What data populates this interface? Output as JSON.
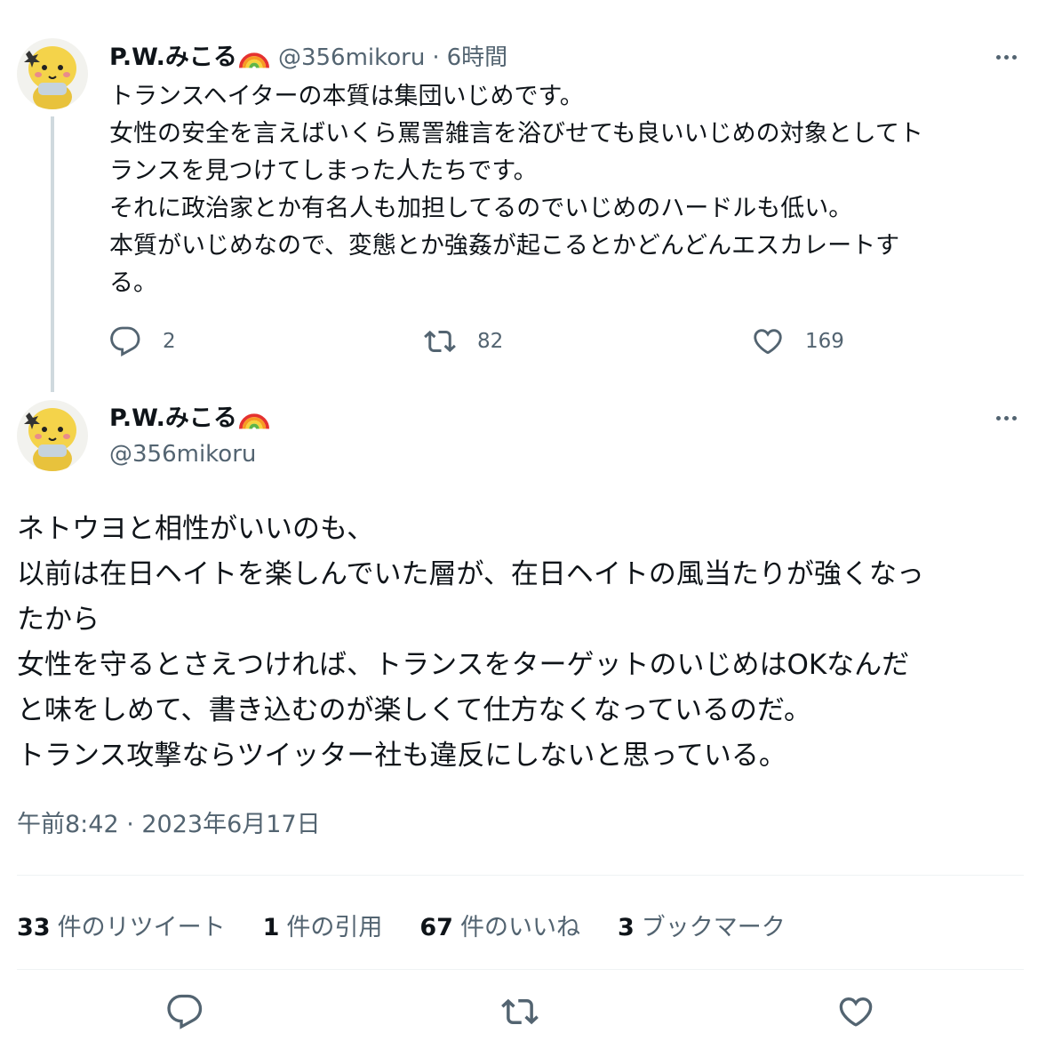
{
  "parent_tweet": {
    "display_name": "P.W.みこる",
    "handle": "@356mikoru",
    "separator": "·",
    "time_ago": "6時間",
    "lines": [
      "トランスヘイターの本質は集団いじめです。",
      "女性の安全を言えばいくら罵詈雑言を浴びせても良いいじめの対象としてト",
      "ランスを見つけてしまった人たちです。",
      "それに政治家とか有名人も加担してるのでいじめのハードルも低い。",
      "本質がいじめなので、変態とか強姦が起こるとかどんどんエスカレートす",
      "る。"
    ],
    "replies": "2",
    "retweets": "82",
    "likes": "169"
  },
  "main_tweet": {
    "display_name": "P.W.みこる",
    "handle": "@356mikoru",
    "lines": [
      "ネトウヨと相性がいいのも、",
      "以前は在日ヘイトを楽しんでいた層が、在日ヘイトの風当たりが強くなっ",
      "たから",
      "女性を守るとさえつければ、トランスをターゲットのいじめはOKなんだ",
      "と味をしめて、書き込むのが楽しくて仕方なくなっているのだ。",
      "トランス攻撃ならツイッター社も違反にしないと思っている。"
    ],
    "timestamp": "午前8:42 · 2023年6月17日",
    "stats": {
      "retweets_count": "33",
      "retweets_label": "件のリツイート",
      "quotes_count": "1",
      "quotes_label": "件の引用",
      "likes_count": "67",
      "likes_label": "件のいいね",
      "bookmarks_count": "3",
      "bookmarks_label": "ブックマーク"
    }
  },
  "icons": {
    "reply": "reply-icon",
    "retweet": "retweet-icon",
    "like": "heart-icon",
    "more": "more-icon",
    "verified_emoji": "rainbow-emoji"
  },
  "colors": {
    "text": "#0f1419",
    "secondary": "#536471",
    "thread_line": "#cfd9de",
    "divider": "#eff3f4"
  }
}
